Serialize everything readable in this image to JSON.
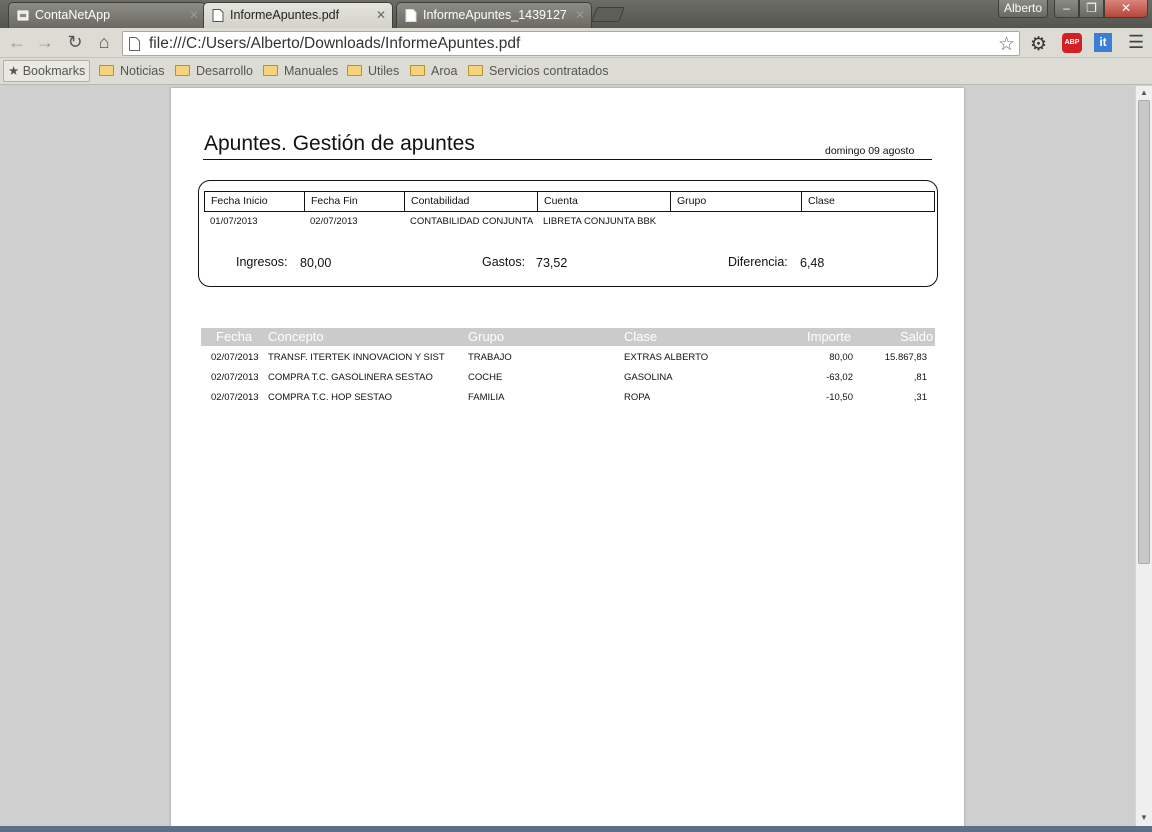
{
  "browser": {
    "tabs": [
      {
        "title": "ContaNetApp",
        "active": false
      },
      {
        "title": "InformeApuntes.pdf",
        "active": true
      },
      {
        "title": "InformeApuntes_1439127",
        "active": false
      }
    ],
    "profile_name": "Alberto",
    "url": "file:///C:/Users/Alberto/Downloads/InformeApuntes.pdf",
    "icons": {
      "back": "back-arrow-icon",
      "forward": "forward-arrow-icon",
      "reload": "reload-icon",
      "home": "home-icon",
      "bookmark_star": "star-icon",
      "settings": "gear-icon",
      "adblock": "abp-icon",
      "extension": "it-icon",
      "menu": "hamburger-menu-icon"
    },
    "adblock_label": "ABP",
    "ext_label": "it"
  },
  "bookmarks_bar": {
    "bookmarks_label": "Bookmarks",
    "folders": [
      "Noticias",
      "Desarrollo",
      "Manuales",
      "Utiles",
      "Aroa",
      "Servicios contratados"
    ]
  },
  "report": {
    "title": "Apuntes. Gestión de apuntes",
    "date": "domingo 09 agosto",
    "filters": {
      "headers": [
        "Fecha Inicio",
        "Fecha Fin",
        "Contabilidad",
        "Cuenta",
        "Grupo",
        "Clase"
      ],
      "values": [
        "01/07/2013",
        "02/07/2013",
        "CONTABILIDAD CONJUNTA",
        "LIBRETA CONJUNTA BBK",
        "",
        ""
      ]
    },
    "totals": {
      "ingresos_label": "Ingresos:",
      "ingresos_value": "80,00",
      "gastos_label": "Gastos:",
      "gastos_value": "73,52",
      "diferencia_label": "Diferencia:",
      "diferencia_value": "6,48"
    },
    "list": {
      "headers": [
        "Fecha",
        "Concepto",
        "Grupo",
        "Clase",
        "Importe",
        "Saldo"
      ],
      "rows": [
        {
          "fecha": "02/07/2013",
          "concepto": "TRANSF. ITERTEK INNOVACION Y SIST",
          "grupo": "TRABAJO",
          "clase": "EXTRAS ALBERTO",
          "importe": "80,00",
          "saldo": "15.867,83"
        },
        {
          "fecha": "02/07/2013",
          "concepto": "COMPRA T.C. GASOLINERA SESTAO",
          "grupo": "COCHE",
          "clase": "GASOLINA",
          "importe": "-63,02",
          "saldo": ",81"
        },
        {
          "fecha": "02/07/2013",
          "concepto": "COMPRA T.C. HOP  SESTAO",
          "grupo": "FAMILIA",
          "clase": "ROPA",
          "importe": "-10,50",
          "saldo": ",31"
        }
      ]
    }
  },
  "colors": {
    "titlebar": "#5f5f59",
    "toolbar": "#dcdcd4",
    "list_header": "#cbcbcb",
    "close_button": "#c05a4e"
  }
}
